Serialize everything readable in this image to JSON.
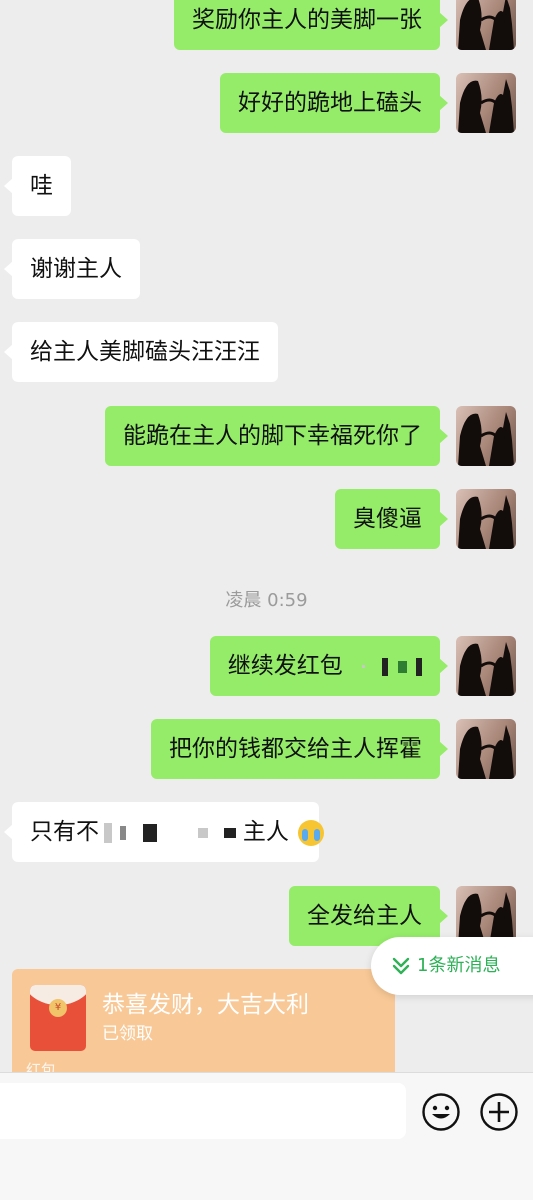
{
  "messages": [
    {
      "side": "me",
      "text": "奖励你主人的美脚一张"
    },
    {
      "side": "me",
      "text": "好好的跪地上磕头"
    },
    {
      "side": "other",
      "text": "哇"
    },
    {
      "side": "other",
      "text": "谢谢主人"
    },
    {
      "side": "other",
      "text": "给主人美脚磕头汪汪汪"
    },
    {
      "side": "me",
      "text": "能跪在主人的脚下幸福死你了"
    },
    {
      "side": "me",
      "text": "臭傻逼"
    },
    {
      "side": "me",
      "text": "继续发红包"
    },
    {
      "side": "me",
      "text": "把你的钱都交给主人挥霍"
    },
    {
      "side": "other",
      "text_start": "只有不",
      "text_end": "主人"
    },
    {
      "side": "me",
      "text": "全发给主人"
    }
  ],
  "timestamp": "凌晨 0:59",
  "red_packet": {
    "title": "恭喜发财，大吉大利",
    "status": "已领取",
    "footer": "红包"
  },
  "new_messages": "1条新消息",
  "colors": {
    "background": "#ededed",
    "my_bubble": "#95ec69",
    "other_bubble": "#ffffff",
    "red_packet": "#f8c896",
    "new_message_text": "#2eb157"
  },
  "icons": {
    "avatar": "silhouette-avatar",
    "new_messages": "double-chevron-down-icon",
    "emoji": "smiley-icon",
    "more": "plus-circle-icon",
    "crying": "loudly-crying-emoji"
  }
}
